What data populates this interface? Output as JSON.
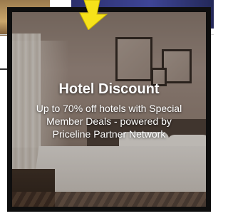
{
  "promo": {
    "title": "Hotel Discount",
    "description_line1": "Up to 70% off hotels with Special",
    "description_line2": "Member Deals - powered by",
    "description_line3": "Priceline Partner Network"
  },
  "colors": {
    "card_border": "#0e0e0e",
    "text": "#ffffff",
    "arrow": "#f6e21a"
  },
  "icons": {
    "arrow": "arrow-down-icon"
  }
}
